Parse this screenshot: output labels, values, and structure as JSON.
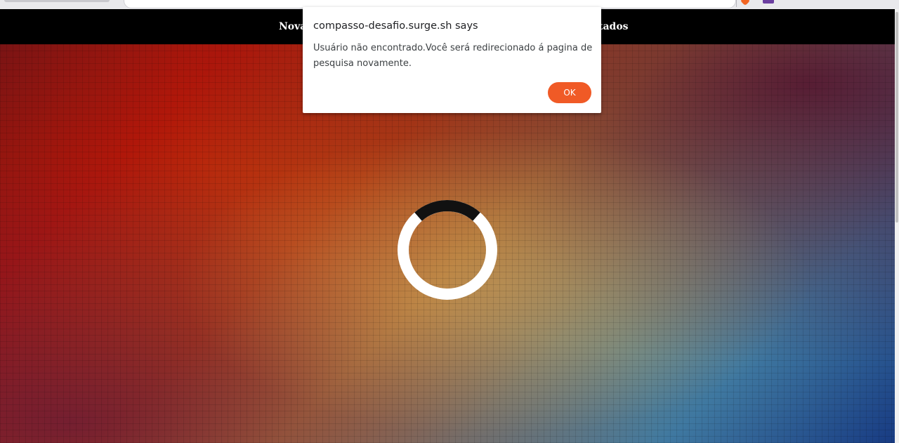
{
  "nav": {
    "left_label": "Nova",
    "right_label": "tados"
  },
  "dialog": {
    "origin": "compasso-desafio.surge.sh says",
    "message": "Usuário não encontrado.Você será redirecionado á pagina de pesquisa novamente.",
    "ok_label": "OK",
    "ok_color": "#f05a26"
  },
  "loader": {
    "ring_color": "#ffffff",
    "accent_color": "#111111"
  },
  "colors": {
    "nav_bg": "#000000"
  }
}
